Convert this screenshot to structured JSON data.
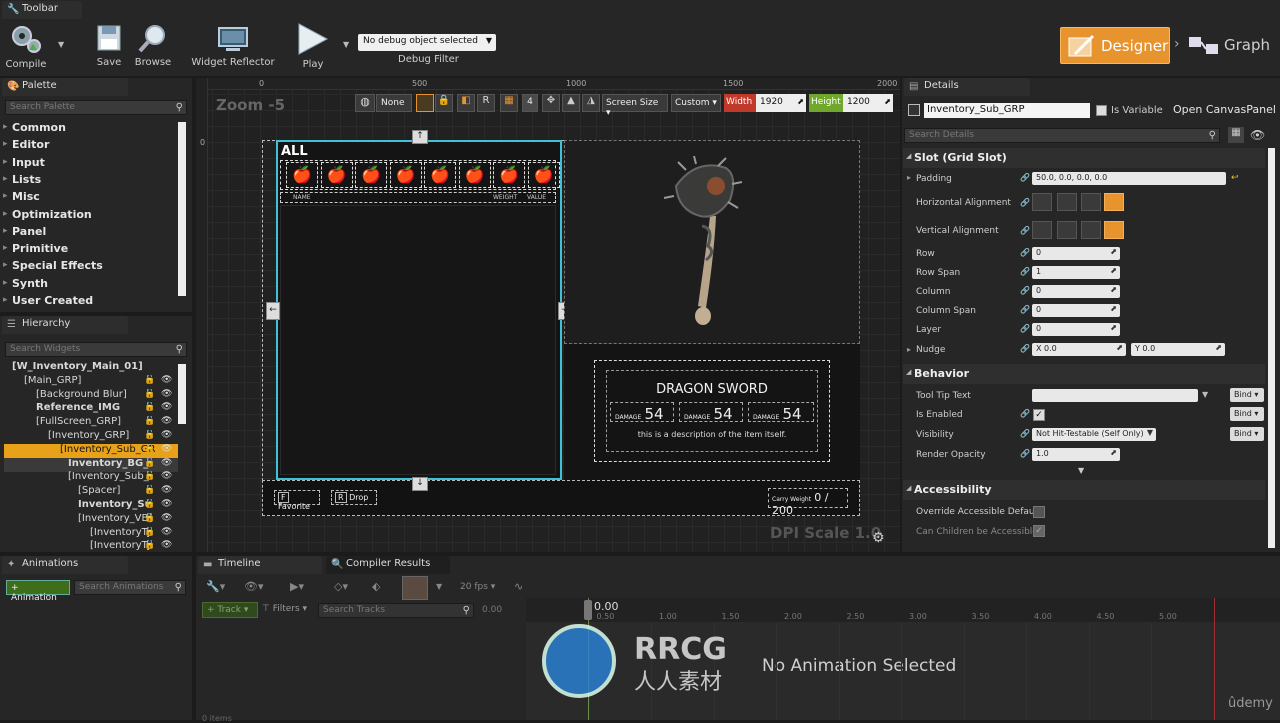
{
  "toolbar": {
    "tab_label": "Toolbar",
    "buttons": {
      "compile": "Compile",
      "save": "Save",
      "browse": "Browse",
      "widget_reflector": "Widget Reflector",
      "play": "Play"
    },
    "debug_dropdown": "No debug object selected",
    "debug_filter_label": "Debug Filter",
    "designer": "Designer",
    "graph": "Graph"
  },
  "palette": {
    "tab_label": "Palette",
    "search_placeholder": "Search Palette",
    "categories": [
      "Common",
      "Editor",
      "Input",
      "Lists",
      "Misc",
      "Optimization",
      "Panel",
      "Primitive",
      "Special Effects",
      "Synth",
      "User Created"
    ]
  },
  "hierarchy": {
    "tab_label": "Hierarchy",
    "search_placeholder": "Search Widgets",
    "items": [
      {
        "label": "[W_Inventory_Main_01]"
      },
      {
        "label": "[Main_GRP]"
      },
      {
        "label": "[Background Blur]"
      },
      {
        "label": "Reference_IMG"
      },
      {
        "label": "[FullScreen_GRP]"
      },
      {
        "label": "[Inventory_GRP]"
      },
      {
        "label": "[Inventory_Sub_GR"
      },
      {
        "label": "Inventory_BG_"
      },
      {
        "label": "[Inventory_Sub_"
      },
      {
        "label": "[Spacer]"
      },
      {
        "label": "Inventory_Su"
      },
      {
        "label": "[Inventory_VB]"
      },
      {
        "label": "[InventoryTy"
      },
      {
        "label": "[InventoryTy"
      }
    ]
  },
  "designer": {
    "zoom": "Zoom -5",
    "ruler_marks": [
      "0",
      "500",
      "1000",
      "1500",
      "2000"
    ],
    "none_dropdown": "None",
    "r_button": "R",
    "snap_value": "4",
    "screen_size": "Screen Size",
    "custom": "Custom",
    "width_label": "Width",
    "width_value": "1920",
    "height_label": "Height",
    "height_value": "1200",
    "dpi_scale": "DPI Scale 1.0"
  },
  "canvas": {
    "all_label": "ALL",
    "slot_icon": "🍎",
    "col_name": "NAME",
    "col_weight": "WEIGHT",
    "col_value": "VALUE",
    "item_title": "DRAGON SWORD",
    "damage_label": "DAMAGE",
    "damage_values": [
      "54",
      "54",
      "54"
    ],
    "description": "this is a description of the item itself.",
    "favorite_key": "F",
    "favorite_label": "Favorite",
    "drop_key": "R",
    "drop_label": "Drop",
    "carry_label": "Carry Weight",
    "carry_value": "0 / 200"
  },
  "details": {
    "tab_label": "Details",
    "widget_name": "Inventory_Sub_GRP",
    "is_variable_label": "Is Variable",
    "open_canvas": "Open CanvasPanel",
    "search_placeholder": "Search Details",
    "slot_section": "Slot (Grid Slot)",
    "padding_label": "Padding",
    "padding_value": "50.0, 0.0, 0.0, 0.0",
    "h_align_label": "Horizontal Alignment",
    "v_align_label": "Vertical Alignment",
    "row_label": "Row",
    "row_value": "0",
    "row_span_label": "Row Span",
    "row_span_value": "1",
    "column_label": "Column",
    "column_value": "0",
    "column_span_label": "Column Span",
    "column_span_value": "0",
    "layer_label": "Layer",
    "layer_value": "0",
    "nudge_label": "Nudge",
    "nudge_x": "X 0.0",
    "nudge_y": "Y 0.0",
    "behavior_section": "Behavior",
    "tooltip_label": "Tool Tip Text",
    "is_enabled_label": "Is Enabled",
    "visibility_label": "Visibility",
    "visibility_value": "Not Hit-Testable (Self Only)",
    "render_opacity_label": "Render Opacity",
    "render_opacity_value": "1.0",
    "bind_label": "Bind",
    "accessibility_section": "Accessibility",
    "override_label": "Override Accessible Defaults",
    "children_label": "Can Children be Accessible"
  },
  "animations": {
    "tab_label": "Animations",
    "add_button": "+ Animation",
    "search_placeholder": "Search Animations",
    "items_count": "0 items"
  },
  "timeline": {
    "tab_label": "Timeline",
    "compiler_tab": "Compiler Results",
    "fps": "20 fps",
    "track_button": "Track",
    "filters": "Filters",
    "search_placeholder": "Search Tracks",
    "time_field": "0.00",
    "current_time": "0.00",
    "ticks": [
      "0.00",
      "0.50",
      "1.00",
      "1.50",
      "2.00",
      "2.50",
      "3.00",
      "3.50",
      "4.00",
      "4.50",
      "5.00"
    ],
    "empty_message": "No Animation Selected"
  },
  "watermark": {
    "brand": "RRCG",
    "sub": "人人素材",
    "udemy": "ûdemy"
  },
  "colors": {
    "accent": "#e7932e",
    "selection": "#e7a21a",
    "canvas_outline": "#3fc2d6",
    "width_red": "#c0392b",
    "height_green": "#6fa82a"
  }
}
